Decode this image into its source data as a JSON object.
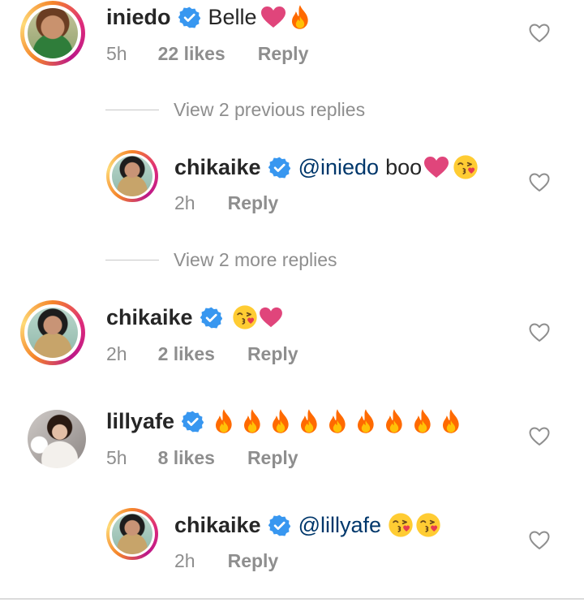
{
  "comments": [
    {
      "username": "iniedo",
      "text": "Belle",
      "time": "5h",
      "likes": "22 likes",
      "reply": "Reply",
      "emojis": [
        "pink-heart",
        "fire"
      ]
    },
    {
      "view_replies": "View 2 previous replies"
    },
    {
      "username": "chikaike",
      "mention": "@iniedo",
      "text": "boo",
      "time": "2h",
      "reply": "Reply",
      "emojis": [
        "pink-heart",
        "kissing-face"
      ]
    },
    {
      "view_replies": "View 2 more replies"
    },
    {
      "username": "chikaike",
      "time": "2h",
      "likes": "2 likes",
      "reply": "Reply",
      "emojis": [
        "kissing-face",
        "pink-heart"
      ]
    },
    {
      "username": "lillyafe",
      "time": "5h",
      "likes": "8 likes",
      "reply": "Reply",
      "emojis": [
        "fire",
        "fire",
        "fire",
        "fire",
        "fire",
        "fire",
        "fire",
        "fire",
        "fire"
      ]
    },
    {
      "username": "chikaike",
      "mention": "@lillyafe",
      "time": "2h",
      "reply": "Reply",
      "emojis": [
        "kissing-face",
        "kissing-face"
      ]
    }
  ],
  "colors": {
    "verified": "#3897f0",
    "mention": "#00376b",
    "meta": "#8e8e8e",
    "heart": "#e0457b",
    "fire": "#ff6a00"
  }
}
